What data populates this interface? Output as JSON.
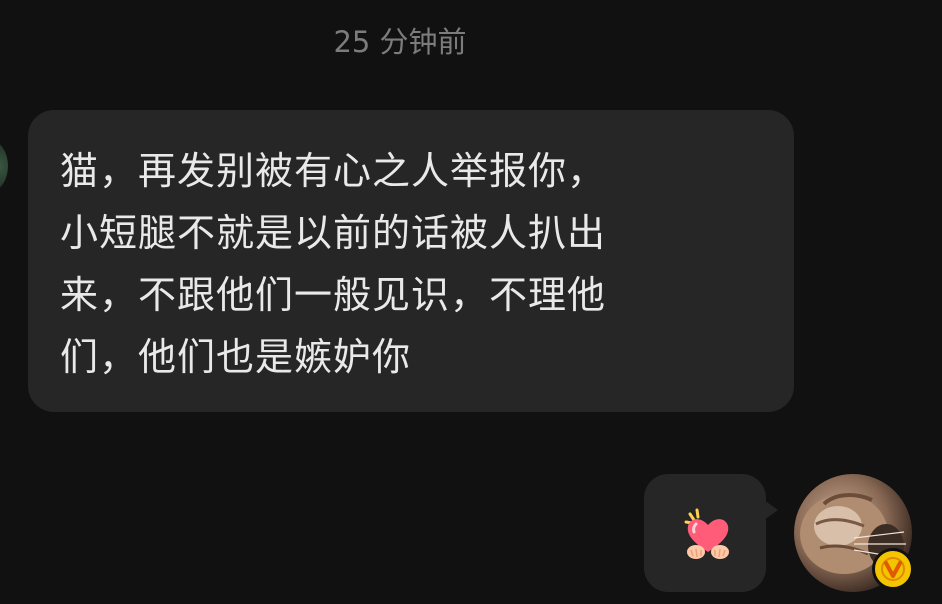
{
  "conversation": {
    "timestamp": "25 分钟前",
    "incoming": {
      "lines": [
        "猫，再发别被有心之人举报你，",
        "小短腿不就是以前的话被人扒出",
        "来，不跟他们一般见识，不理他",
        "们，他们也是嫉妒你"
      ]
    },
    "outgoing": {
      "sticker": "heart-hands-sticker-icon"
    }
  },
  "colors": {
    "background": "#111111",
    "bubble": "#262626",
    "text": "#e9e9e9",
    "timestamp": "#7c7c7c",
    "badge": "#f5c400",
    "heart": "#ff5c7a"
  }
}
